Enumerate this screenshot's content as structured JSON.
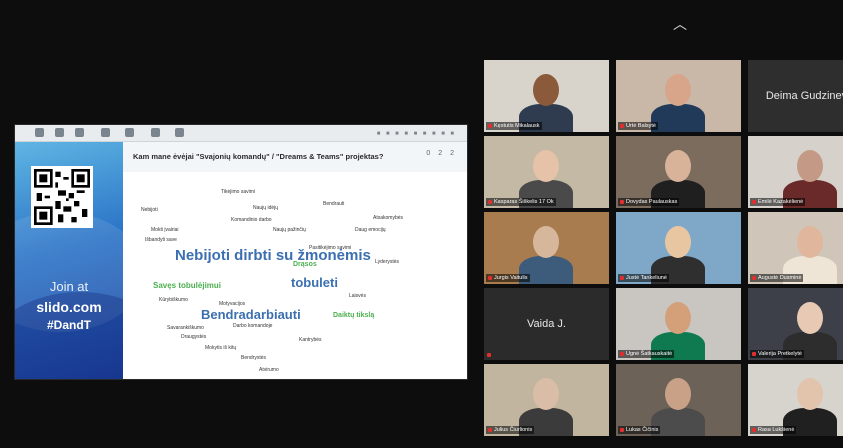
{
  "shared_screen": {
    "question": "Kam mane ėvėjai \"Svajonių komandų\" / \"Dreams & Teams\" projektas?",
    "question_icons": "0 2 2",
    "join_label": "Join at",
    "join_site": "slido.com",
    "join_code": "#DandT"
  },
  "word_cloud": [
    {
      "text": "Nebijoti dirbti su žmonėmis",
      "size": 15,
      "color": "#3b6fb0",
      "weight": "bold"
    },
    {
      "text": "Bendradarbiauti",
      "size": 13,
      "color": "#3b6fb0",
      "weight": "bold"
    },
    {
      "text": "tobuleti",
      "size": 13,
      "color": "#3b6fb0",
      "weight": "bold"
    },
    {
      "text": "Savęs tobulėjimui",
      "size": 8,
      "color": "#4caf50",
      "weight": "bold"
    },
    {
      "text": "Drąsos",
      "size": 7,
      "color": "#4caf50",
      "weight": "bold"
    },
    {
      "text": "Daiktų tikslą",
      "size": 7,
      "color": "#4caf50",
      "weight": "bold"
    },
    {
      "text": "Tikėjimo savimi",
      "size": 5,
      "color": "#333333",
      "weight": "normal"
    },
    {
      "text": "Bendrauti",
      "size": 5,
      "color": "#333333",
      "weight": "normal"
    },
    {
      "text": "Nebijoti",
      "size": 5,
      "color": "#333333",
      "weight": "normal"
    },
    {
      "text": "Komandinio darbo",
      "size": 5,
      "color": "#333333",
      "weight": "normal"
    },
    {
      "text": "Naujų pažinčių",
      "size": 5,
      "color": "#333333",
      "weight": "normal"
    },
    {
      "text": "Mokti įvairiai",
      "size": 5,
      "color": "#333333",
      "weight": "normal"
    },
    {
      "text": "Savarankiškumo",
      "size": 5,
      "color": "#333333",
      "weight": "normal"
    },
    {
      "text": "Daug emocijų",
      "size": 5,
      "color": "#333333",
      "weight": "normal"
    },
    {
      "text": "Išbandyti save",
      "size": 5,
      "color": "#333333",
      "weight": "normal"
    },
    {
      "text": "Pasitikėjimo savimi",
      "size": 5,
      "color": "#333333",
      "weight": "normal"
    },
    {
      "text": "Kūrybiškumo",
      "size": 5,
      "color": "#333333",
      "weight": "normal"
    },
    {
      "text": "Naujų idėjų",
      "size": 5,
      "color": "#333333",
      "weight": "normal"
    },
    {
      "text": "Laisvės",
      "size": 5,
      "color": "#333333",
      "weight": "normal"
    },
    {
      "text": "Draugystės",
      "size": 5,
      "color": "#333333",
      "weight": "normal"
    },
    {
      "text": "Atsakomybės",
      "size": 5,
      "color": "#333333",
      "weight": "normal"
    },
    {
      "text": "Lyderystės",
      "size": 5,
      "color": "#333333",
      "weight": "normal"
    },
    {
      "text": "Mokytis iš kitų",
      "size": 5,
      "color": "#333333",
      "weight": "normal"
    },
    {
      "text": "Darbo komandoje",
      "size": 5,
      "color": "#333333",
      "weight": "normal"
    },
    {
      "text": "Bendrystės",
      "size": 5,
      "color": "#333333",
      "weight": "normal"
    },
    {
      "text": "Atvirumo",
      "size": 5,
      "color": "#333333",
      "weight": "normal"
    },
    {
      "text": "Motyvacijos",
      "size": 5,
      "color": "#333333",
      "weight": "normal"
    },
    {
      "text": "Kantrybės",
      "size": 5,
      "color": "#333333",
      "weight": "normal"
    }
  ],
  "participants": [
    {
      "name": "Kęstutis Mikalausk",
      "muted": true
    },
    {
      "name": "Urtė Balsytė",
      "muted": true
    },
    {
      "name": "Deima Gudzinevič",
      "muted": false
    },
    {
      "name": "Kasparas Šiškelis 17 Ok",
      "muted": true
    },
    {
      "name": "Dovydas Paulauskas",
      "muted": true
    },
    {
      "name": "Emilė Kazakėlienė",
      "muted": true
    },
    {
      "name": "Jurgis Vaitulis",
      "muted": true
    },
    {
      "name": "Justė Tankeliunė",
      "muted": true
    },
    {
      "name": "Augustė Dusminė",
      "muted": true
    },
    {
      "name": "Vaida J.",
      "muted": true
    },
    {
      "name": "Ugnė Šatkauskaitė",
      "muted": true
    },
    {
      "name": "Valerija Pretkelytė",
      "muted": true
    },
    {
      "name": "Julius Čiurlionis",
      "muted": true
    },
    {
      "name": "Lukas Čičinis",
      "muted": true
    },
    {
      "name": "Rasa Lukšienė",
      "muted": true
    }
  ]
}
